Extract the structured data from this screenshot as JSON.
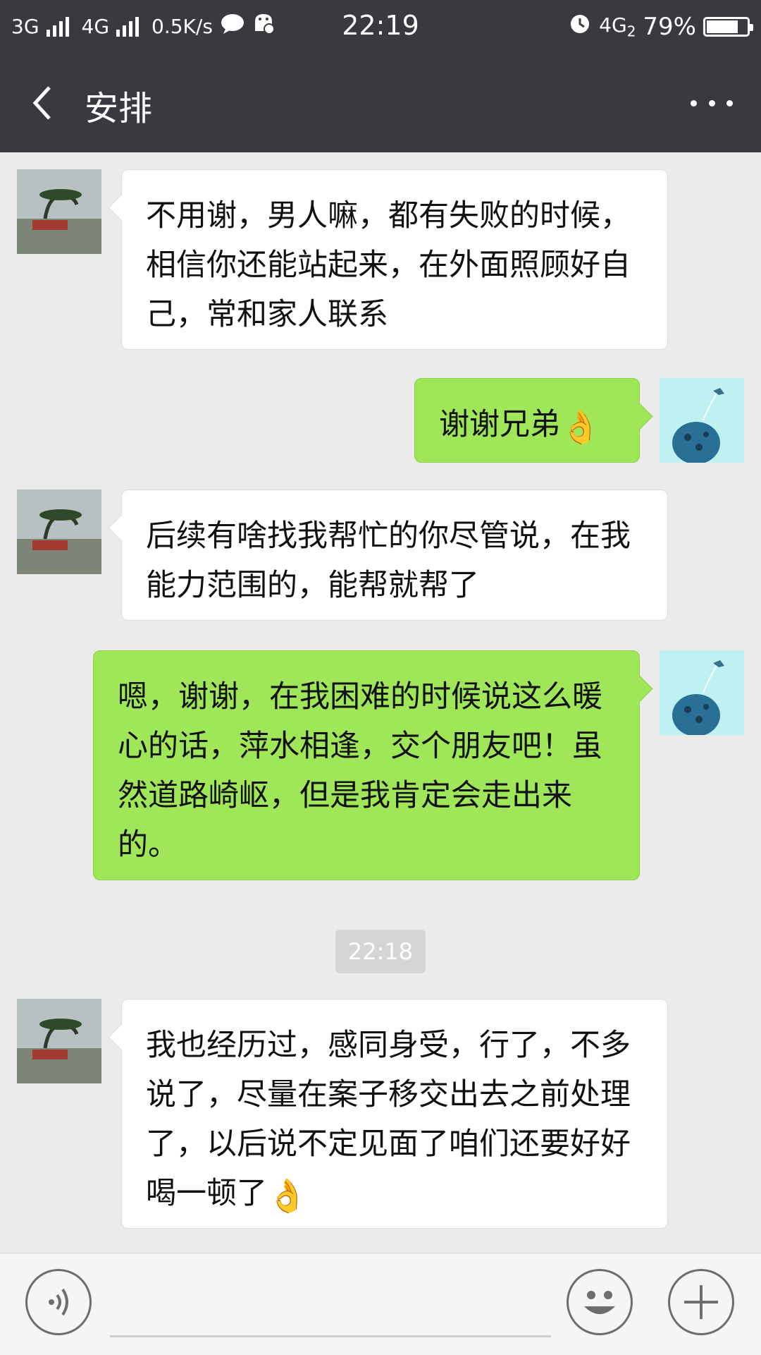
{
  "status_bar": {
    "net1": "3G",
    "net2": "4G",
    "speed": "0.5K/s",
    "time": "22:19",
    "net3": "4G",
    "net3_sub": "2",
    "battery": "79%",
    "battery_level": 0.79
  },
  "header": {
    "title": "安排"
  },
  "messages": [
    {
      "side": "in",
      "text": "不用谢，男人嘛，都有失败的时候，相信你还能站起来，在外面照顾好自己，常和家人联系"
    },
    {
      "side": "out",
      "text": "谢谢兄弟",
      "emoji": "👌"
    },
    {
      "side": "in",
      "text": "后续有啥找我帮忙的你尽管说，在我能力范围的，能帮就帮了"
    },
    {
      "side": "out",
      "text": "嗯，谢谢，在我困难的时候说这么暖心的话，萍水相逢，交个朋友吧！虽然道路崎岖，但是我肯定会走出来的。"
    },
    {
      "side": "in",
      "text": "我也经历过，感同身受，行了，不多说了，尽量在案子移交出去之前处理了，以后说不定见面了咱们还要好好喝一顿了",
      "emoji": "👌"
    }
  ],
  "timestamp": "22:18",
  "icons": {
    "back": "chevron-left-icon",
    "more": "more-dots-icon",
    "voice": "voice-icon",
    "emoji": "smiley-icon",
    "plus": "plus-icon"
  }
}
